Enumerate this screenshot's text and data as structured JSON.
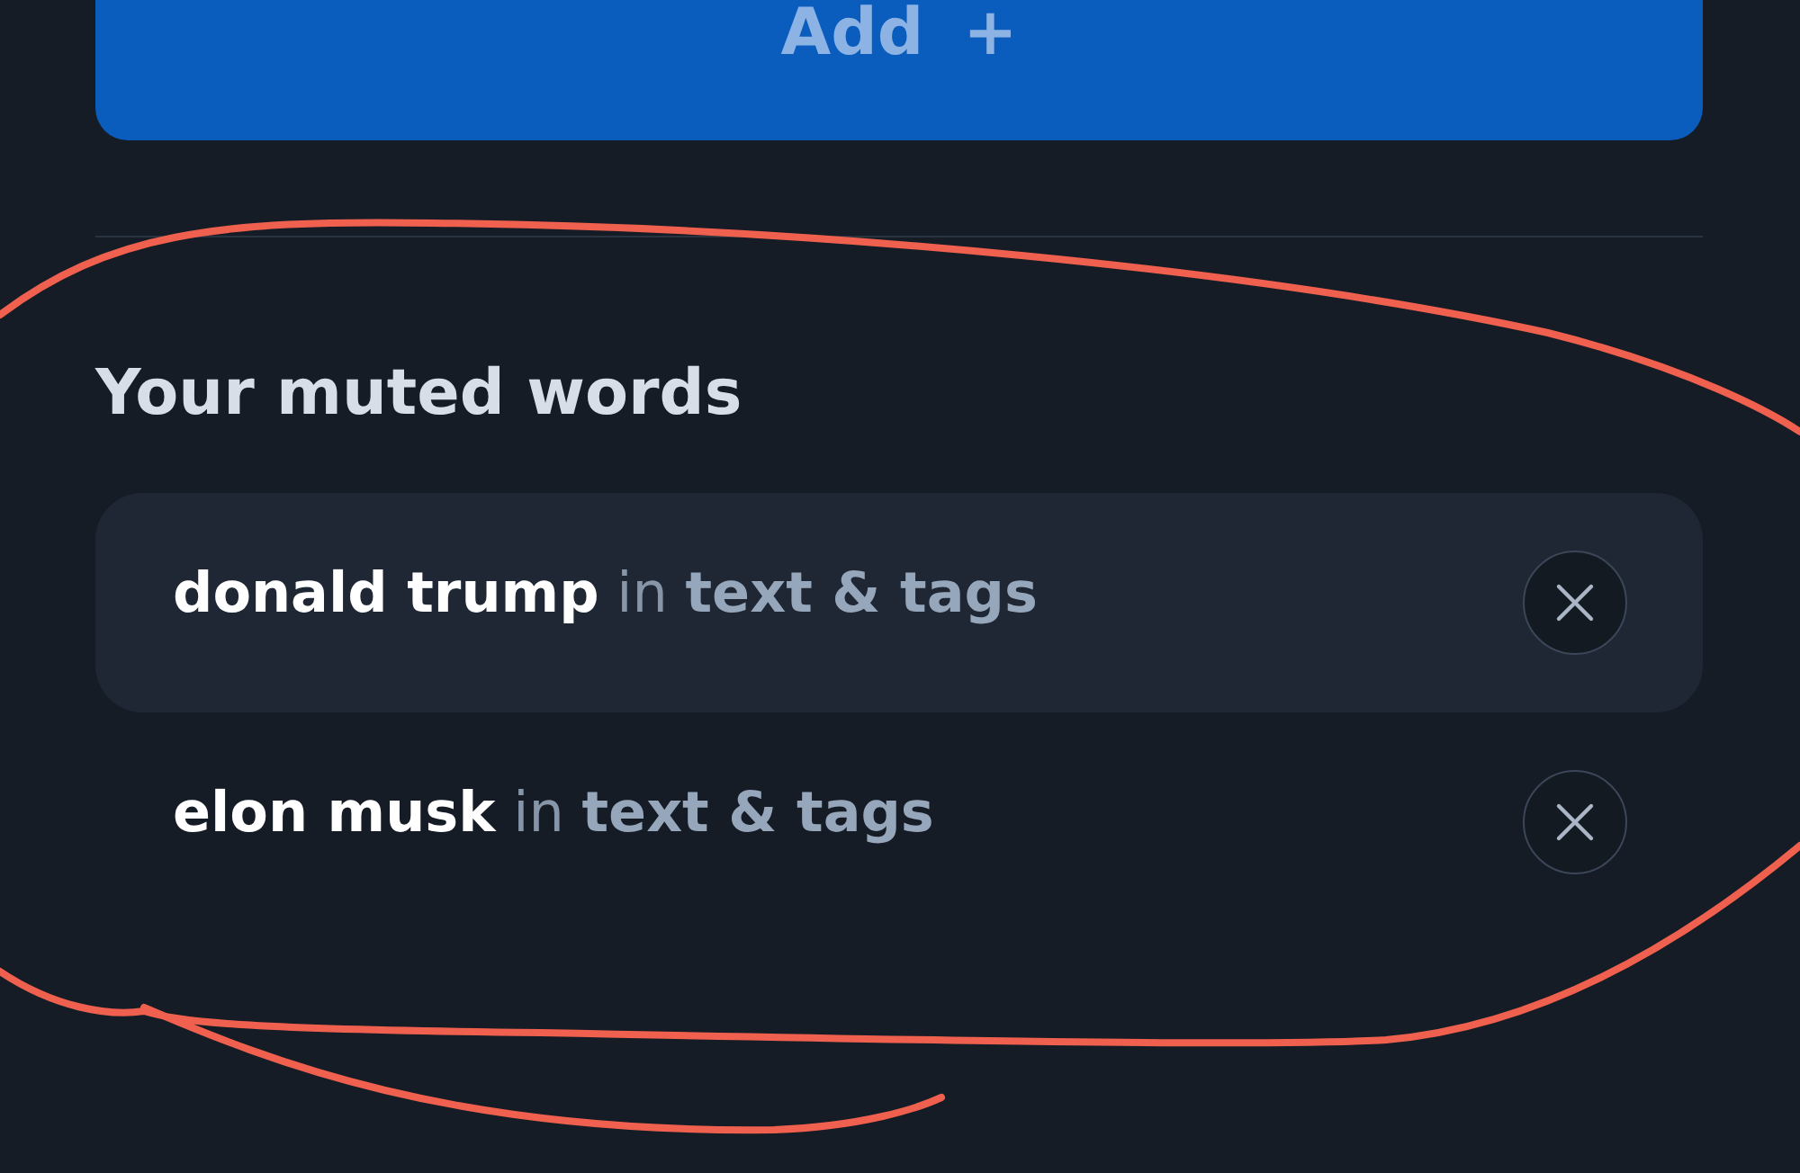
{
  "add_button": {
    "label": "Add",
    "icon": "+"
  },
  "section": {
    "title": "Your muted words"
  },
  "muted_words": [
    {
      "text": "**donald trump** in **text & tags**",
      "selected": true
    },
    {
      "text": "**elon musk** in **text & tags**",
      "selected": false
    }
  ],
  "annotation": {
    "kind": "scribble",
    "color": "#f0604f"
  }
}
